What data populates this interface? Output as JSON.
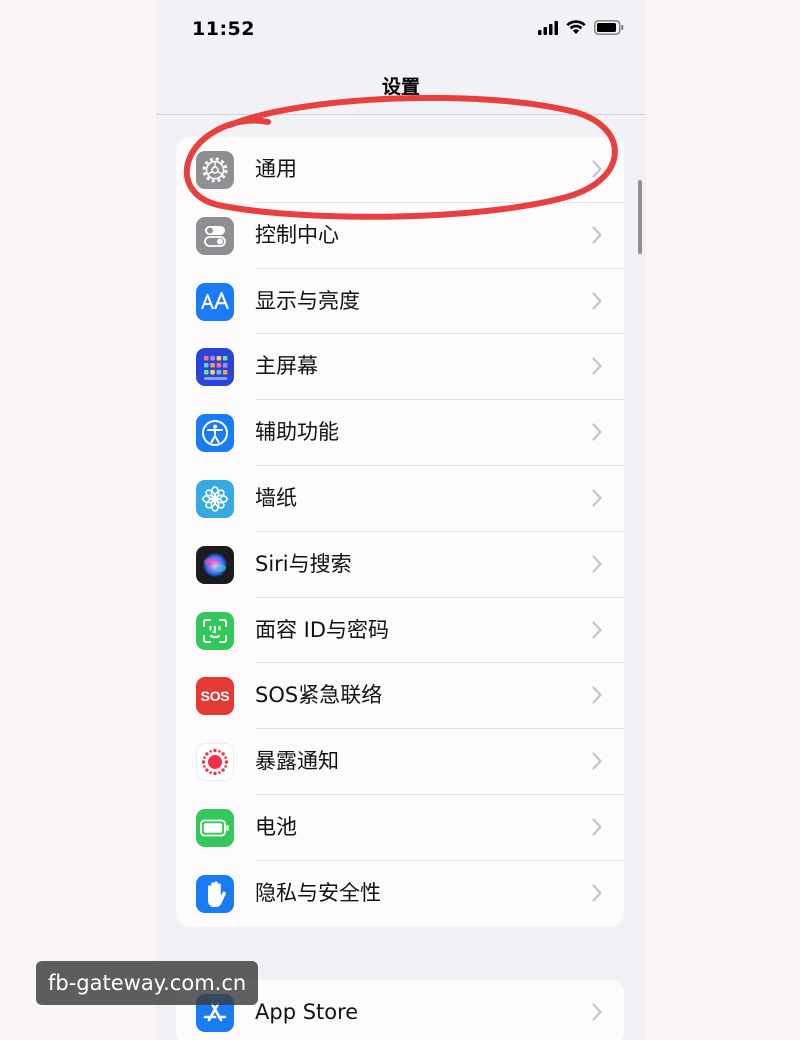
{
  "status_bar": {
    "time": "11:52"
  },
  "nav": {
    "title": "设置"
  },
  "settings_main": [
    {
      "label": "通用",
      "icon": "gear-icon",
      "color": "#8e8e93"
    },
    {
      "label": "控制中心",
      "icon": "toggle-switches-icon",
      "color": "#8e8e93"
    },
    {
      "label": "显示与亮度",
      "icon": "text-size-aa-icon",
      "color": "#1a7cf5"
    },
    {
      "label": "主屏幕",
      "icon": "home-screen-grid-icon",
      "color": "#2845d6"
    },
    {
      "label": "辅助功能",
      "icon": "accessibility-person-icon",
      "color": "#1a7cf5"
    },
    {
      "label": "墙纸",
      "icon": "flower-icon",
      "color": "#36aadf"
    },
    {
      "label": "Siri与搜索",
      "icon": "siri-orb-icon",
      "color": "#1c1c1e"
    },
    {
      "label": "面容 ID与密码",
      "icon": "face-id-icon",
      "color": "#34c759"
    },
    {
      "label": "SOS紧急联络",
      "icon": "sos-icon",
      "color": "#e53935",
      "icon_text": "SOS"
    },
    {
      "label": "暴露通知",
      "icon": "exposure-dots-icon",
      "color": "#ffffff"
    },
    {
      "label": "电池",
      "icon": "battery-icon",
      "color": "#34c759"
    },
    {
      "label": "隐私与安全性",
      "icon": "hand-icon",
      "color": "#1a7cf5"
    }
  ],
  "settings_store": [
    {
      "label": "App Store",
      "icon": "app-store-icon",
      "color": "#1a7cf5"
    }
  ],
  "watermark": {
    "text": "fb-gateway.com.cn"
  },
  "annotation": {
    "color": "#e8403f"
  }
}
